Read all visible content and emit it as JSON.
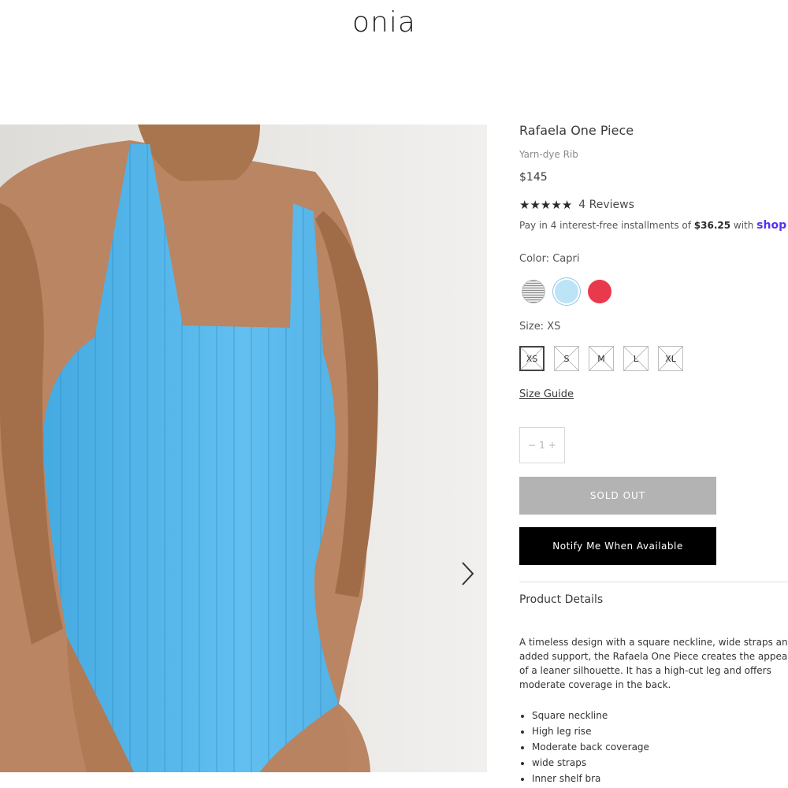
{
  "brand": {
    "logo": "onia"
  },
  "product": {
    "title": "Rafaela One Piece",
    "subtitle": "Yarn-dye Rib",
    "price": "$145",
    "rating": 5,
    "reviews_label": "4 Reviews",
    "installments": {
      "prefix": "Pay in 4 interest-free installments of ",
      "amount": "$36.25",
      "suffix": " with ",
      "provider": "shop"
    },
    "color_label": "Color: Capri",
    "colors": [
      {
        "name": "stripe",
        "hex": "#8d8d8d"
      },
      {
        "name": "Capri",
        "hex": "#bde3f7",
        "selected": true
      },
      {
        "name": "red",
        "hex": "#e83a4c"
      }
    ],
    "size_label": "Size: XS",
    "sizes": [
      "XS",
      "S",
      "M",
      "L",
      "XL"
    ],
    "size_guide": "Size Guide",
    "quantity": {
      "minus": "−",
      "value": "1",
      "plus": "+"
    },
    "sold_out_label": "SOLD OUT",
    "notify_label": "Notify Me When Available",
    "details_heading": "Product Details",
    "description": "A timeless design with a square neckline, wide straps and added support, the Rafaela One Piece creates the appearance of a leaner silhouette. It has a high-cut leg and offers moderate coverage in the back.",
    "features": [
      "Square neckline",
      "High leg rise",
      "Moderate back coverage",
      "wide straps",
      "Inner shelf bra"
    ]
  },
  "gallery": {
    "next_icon": "chevron-right-icon",
    "swimsuit_color": "#4fb3e6"
  }
}
